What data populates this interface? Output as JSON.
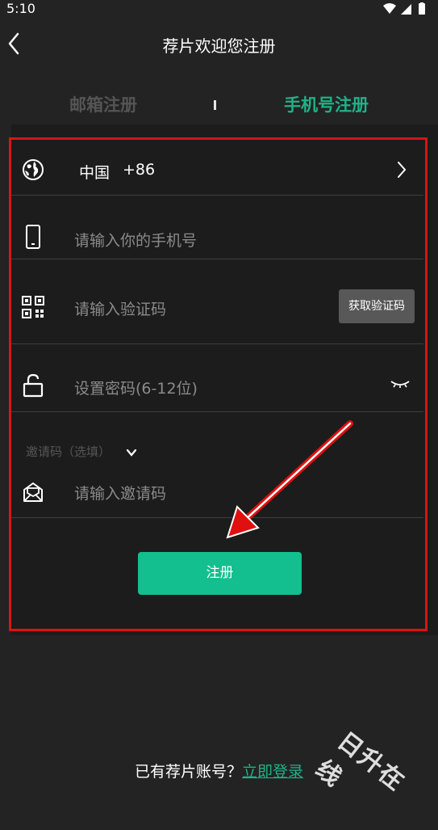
{
  "status_bar": {
    "time": "5:10"
  },
  "header": {
    "title": "荐片欢迎您注册"
  },
  "tabs": [
    {
      "label": "邮箱注册",
      "active": false
    },
    {
      "label": "手机号注册",
      "active": true
    }
  ],
  "form": {
    "country": {
      "name": "中国",
      "code": "+86"
    },
    "phone": {
      "placeholder": "请输入你的手机号"
    },
    "verify": {
      "placeholder": "请输入验证码",
      "button_label": "获取验证码"
    },
    "password": {
      "placeholder": "设置密码(6-12位)"
    },
    "invite": {
      "toggle_label": "邀请码（选填）",
      "placeholder": "请输入邀请码"
    },
    "submit_label": "注册"
  },
  "footer": {
    "text": "已有荐片账号？",
    "link": "立即登录"
  },
  "watermark": "日升在线",
  "colors": {
    "accent": "#1fb287",
    "button": "#13bf8e",
    "highlight": "#d81414",
    "background": "#232323"
  }
}
